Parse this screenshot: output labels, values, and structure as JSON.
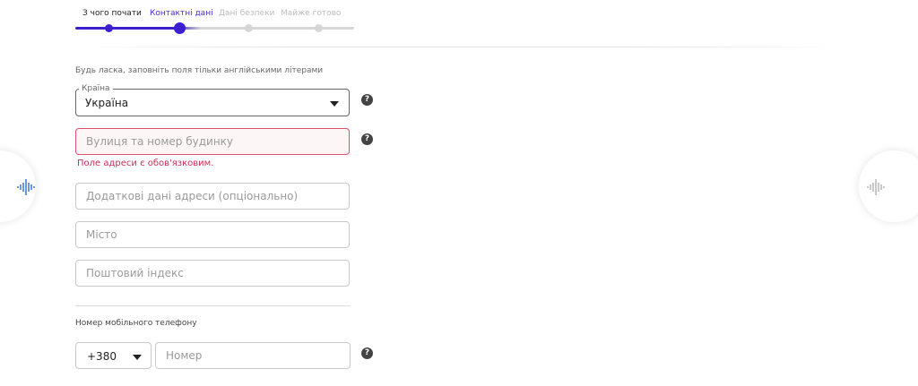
{
  "steps": [
    {
      "label": "З чого почати",
      "state": "done"
    },
    {
      "label": "Контактні дані",
      "state": "active"
    },
    {
      "label": "Дані безпеки",
      "state": "todo"
    },
    {
      "label": "Майже готово",
      "state": "todo"
    }
  ],
  "colors": {
    "accent": "#3b1fd0",
    "error": "#d12d57"
  },
  "hint": "Будь ласка, заповніть поля тільки англійськими літерами",
  "country": {
    "legend": "Країна",
    "value": "Україна"
  },
  "street": {
    "placeholder": "Вулиця та номер будинку",
    "error": "Поле адреси є обов'язковим."
  },
  "extra": {
    "placeholder": "Додаткові дані адреси (опціонально)"
  },
  "city": {
    "placeholder": "Місто"
  },
  "postal": {
    "placeholder": "Поштовий індекс"
  },
  "phone": {
    "label": "Номер мобільного телефону",
    "code": "+380",
    "placeholder": "Номер"
  },
  "help_glyph": "?",
  "icons": {
    "left": "dots-wave-icon",
    "right": "dots-wave-icon"
  }
}
